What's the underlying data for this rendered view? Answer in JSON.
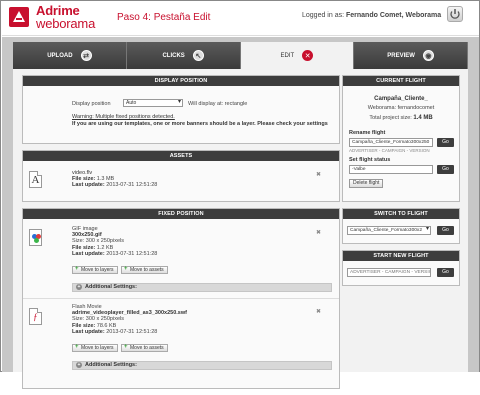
{
  "header": {
    "brand_line1": "Adrime",
    "brand_line2": "weborama",
    "step_title": "Paso 4: Pestaña Edit",
    "logged_prefix": "Logged in as:",
    "logged_user": "Fernando Comet, Weborama"
  },
  "tabs": [
    {
      "label": "UPLOAD",
      "icon": "arrows-icon"
    },
    {
      "label": "CLICKS",
      "icon": "cursor-icon"
    },
    {
      "label": "EDIT",
      "icon": "wrench-icon"
    },
    {
      "label": "PREVIEW",
      "icon": "eye-icon"
    }
  ],
  "display_position": {
    "header": "DISPLAY POSITION",
    "label": "Display position",
    "select_value": "Auto",
    "will_display": "Will display at: rectangle",
    "warning_title": "Warning: Multiple fixed positions detected.",
    "warning_text": "If you are using our templates, one or more banners should be a layer. Please check your settings"
  },
  "assets": {
    "header": "ASSETS",
    "file_name": "video.flv",
    "file_size_label": "File size:",
    "file_size": "1.3 MB",
    "last_update_label": "Last update:",
    "last_update": "2013-07-31 12:51:28"
  },
  "fixed_position": {
    "header": "FIXED POSITION",
    "items": [
      {
        "type": "GIF image",
        "name": "300x250.gif",
        "size_label": "Size:",
        "size": "300 x 250pixels",
        "file_size_label": "File size:",
        "file_size": "1.2 KB",
        "last_update_label": "Last update:",
        "last_update": "2013-07-31 12:51:28",
        "move_layers": "Move to layers",
        "move_assets": "Move to assets",
        "additional": "Additional Settings:"
      },
      {
        "type": "Flash Movie",
        "name": "adrime_videoplayer_filled_as3_300x250.swf",
        "size_label": "Size:",
        "size": "300 x 250pixels",
        "file_size_label": "File size:",
        "file_size": "78.6 KB",
        "last_update_label": "Last update:",
        "last_update": "2013-07-31 12:51:28",
        "move_layers": "Move to layers",
        "move_assets": "Move to assets",
        "additional": "Additional Settings:"
      }
    ]
  },
  "current_flight": {
    "header": "CURRENT FLIGHT",
    "campaign": "Campaña_Cliente_",
    "webrama": "Weborama: fernandocomet",
    "total_label": "Total project size:",
    "total_value": "1.4 MB",
    "rename_label": "Rename flight",
    "rename_value": "Campaña_Cliente_Formato300x250",
    "rename_hint": "ADVERTISER - CAMPAIGN - VERSION",
    "go": "Go",
    "status_label": "Set flight status",
    "status_value": "-Valbe",
    "delete": "Delete flight"
  },
  "switch_flight": {
    "header": "SWITCH TO FLIGHT",
    "select_value": "Campaña_Cliente_Formato300x2",
    "go": "Go"
  },
  "new_flight": {
    "header": "START NEW FLIGHT",
    "placeholder": "ADVERTISER - CAMPAIGN - VERSION",
    "go": "Go"
  }
}
